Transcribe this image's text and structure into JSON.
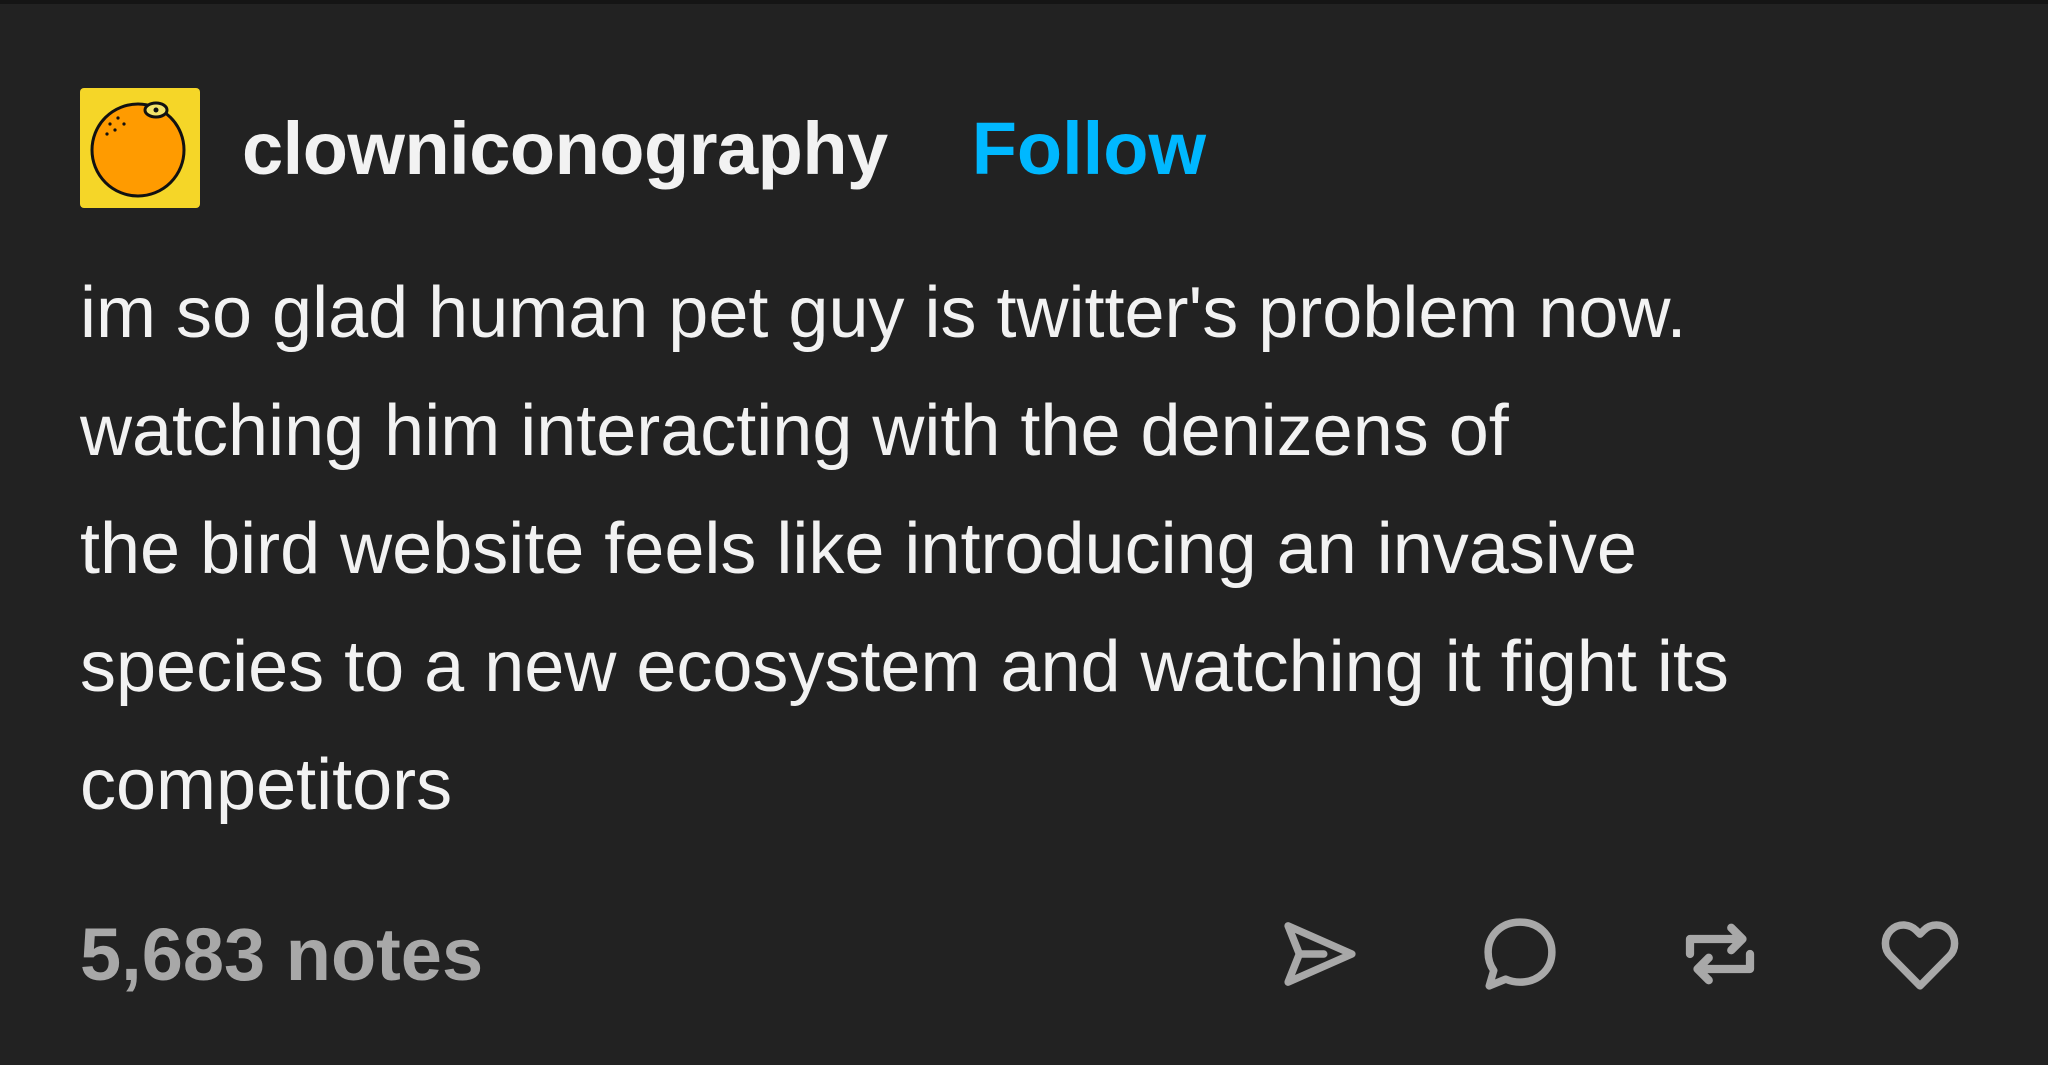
{
  "post": {
    "author": {
      "username": "clowniconography",
      "avatar_icon": "orange-icon",
      "avatar_bg": "#f5d628"
    },
    "follow_label": "Follow",
    "follow_color": "#00b8ff",
    "body_lines": [
      "im so glad human pet guy is twitter's problem now.",
      "watching him interacting with the denizens of",
      "the bird website feels like introducing an invasive",
      "species to a new ecosystem and watching it fight its",
      "competitors"
    ],
    "notes_count": "5,683 notes",
    "actions": [
      {
        "name": "share",
        "icon": "send-icon"
      },
      {
        "name": "reply",
        "icon": "speech-bubble-icon"
      },
      {
        "name": "reblog",
        "icon": "reblog-icon"
      },
      {
        "name": "like",
        "icon": "heart-icon"
      }
    ]
  }
}
